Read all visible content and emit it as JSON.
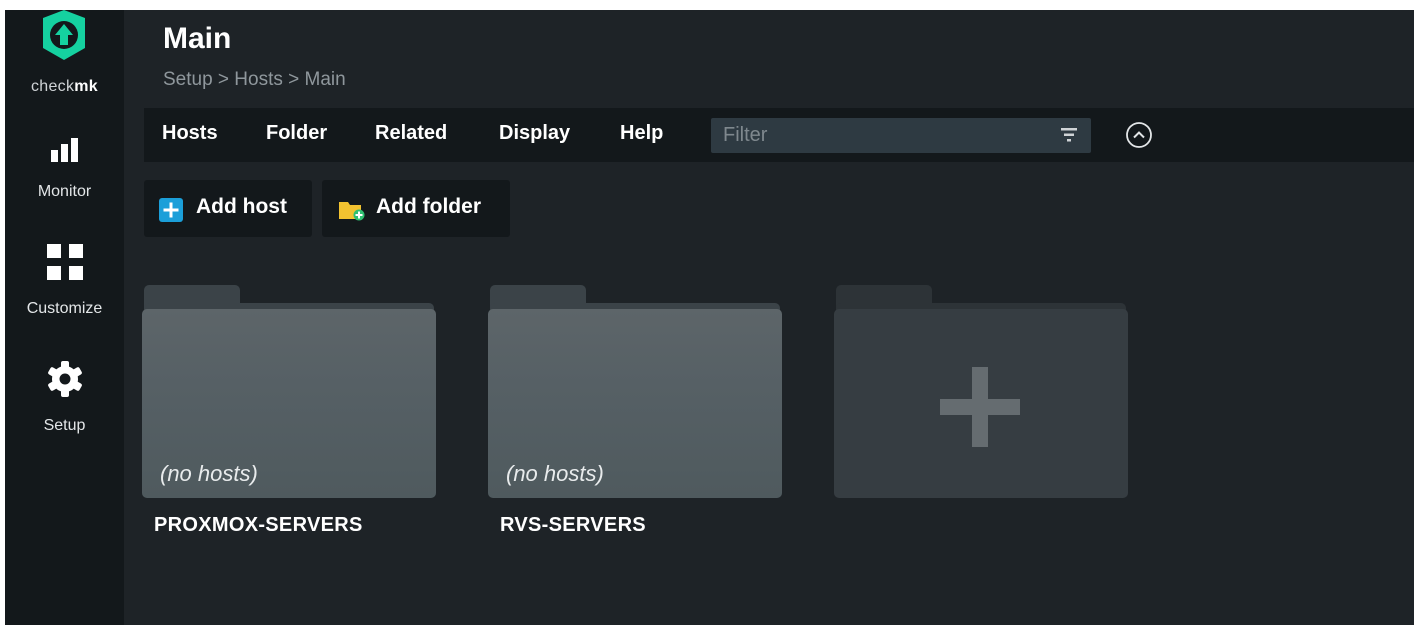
{
  "app": {
    "logo_prefix": "check",
    "logo_suffix": "mk",
    "accent": "#15d1a0"
  },
  "sidebar": {
    "items": [
      {
        "label": "Monitor",
        "icon": "bar-chart-icon"
      },
      {
        "label": "Customize",
        "icon": "grid-icon"
      },
      {
        "label": "Setup",
        "icon": "gear-icon"
      }
    ]
  },
  "header": {
    "title": "Main",
    "breadcrumb": "Setup > Hosts > Main"
  },
  "menubar": {
    "items": [
      "Hosts",
      "Folder",
      "Related",
      "Display",
      "Help"
    ],
    "filter_placeholder": "Filter"
  },
  "toolbar": {
    "add_host": "Add host",
    "add_folder": "Add folder"
  },
  "folders": [
    {
      "name": "PROXMOX-SERVERS",
      "status": "(no hosts)"
    },
    {
      "name": "RVS-SERVERS",
      "status": "(no hosts)"
    }
  ],
  "colors": {
    "background": "#1e2327",
    "sidebar": "#13181b",
    "add_host_icon": "#1b9fd9",
    "add_folder_icon": "#f2c230"
  }
}
